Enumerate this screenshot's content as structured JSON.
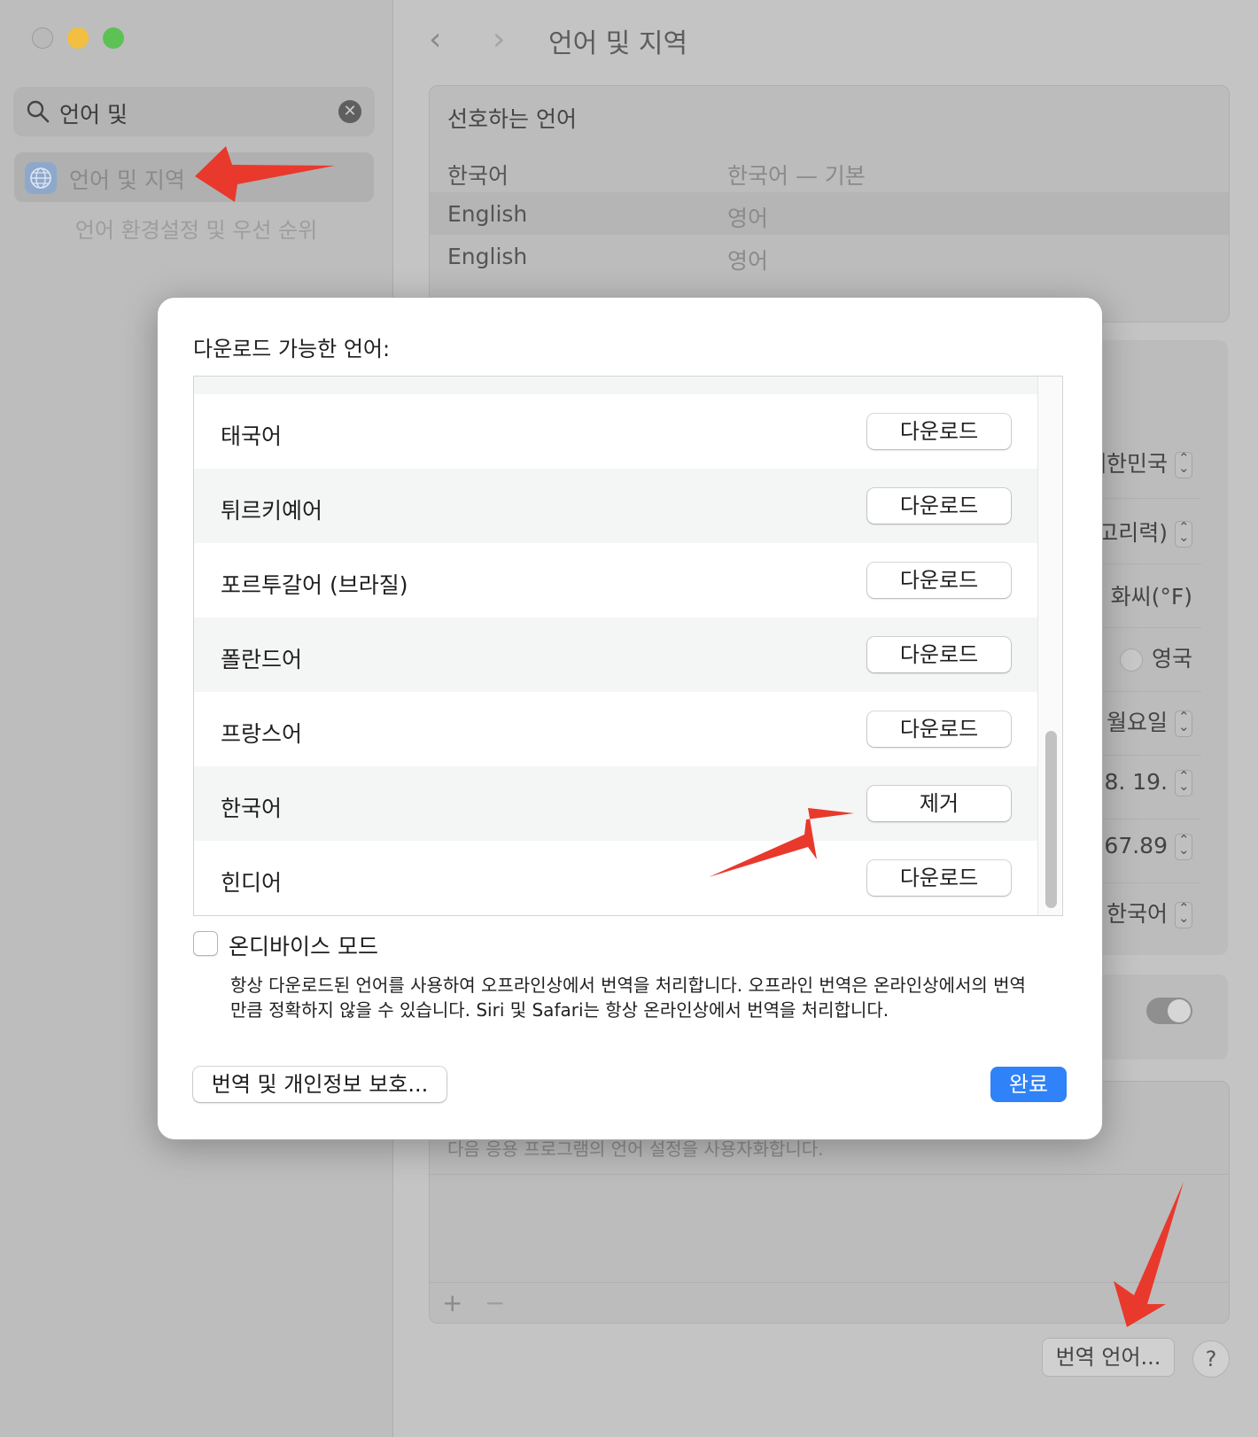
{
  "sidebar": {
    "search_value": "언어 및",
    "item_label": "언어 및 지역",
    "item_subtitle": "언어 환경설정 및 우선 순위"
  },
  "header": {
    "title": "언어 및 지역"
  },
  "preferred_languages": {
    "title": "선호하는 언어",
    "rows": [
      {
        "name": "한국어",
        "detail": "한국어 — 기본"
      },
      {
        "name": "English",
        "detail": "영어"
      },
      {
        "name": "English",
        "detail": "영어"
      }
    ]
  },
  "region_settings": {
    "region": "대한민국",
    "calendar": "양력(그레고리력)",
    "temperature_option": "화씨(°F)",
    "measurement_option": "영국",
    "first_day": "월요일",
    "date_format": "2023. 8. 19.",
    "number_format": "1,234,567.89",
    "list_sort": "한국어"
  },
  "applications": {
    "description": "다음 응용 프로그램의 언어 설정을 사용자화합니다.",
    "add": "+",
    "remove": "−"
  },
  "footer": {
    "translate_button": "번역 언어...",
    "help_button": "?"
  },
  "modal": {
    "title": "다운로드 가능한 언어:",
    "languages": [
      {
        "name": "태국어",
        "action": "다운로드"
      },
      {
        "name": "튀르키예어",
        "action": "다운로드"
      },
      {
        "name": "포르투갈어 (브라질)",
        "action": "다운로드"
      },
      {
        "name": "폴란드어",
        "action": "다운로드"
      },
      {
        "name": "프랑스어",
        "action": "다운로드"
      },
      {
        "name": "한국어",
        "action": "제거"
      },
      {
        "name": "힌디어",
        "action": "다운로드"
      }
    ],
    "on_device_label": "온디바이스 모드",
    "on_device_checked": false,
    "on_device_description": "항상 다운로드된 언어를 사용하여 오프라인상에서 번역을 처리합니다. 오프라인 번역은 온라인상에서의 번역만큼 정확하지 않을 수 있습니다. Siri 및 Safari는 항상 온라인상에서 번역을 처리합니다.",
    "privacy_button": "번역 및 개인정보 보호...",
    "done_button": "완료"
  },
  "colors": {
    "accent": "#2f82f7",
    "annotation_arrow": "#e8392c"
  }
}
